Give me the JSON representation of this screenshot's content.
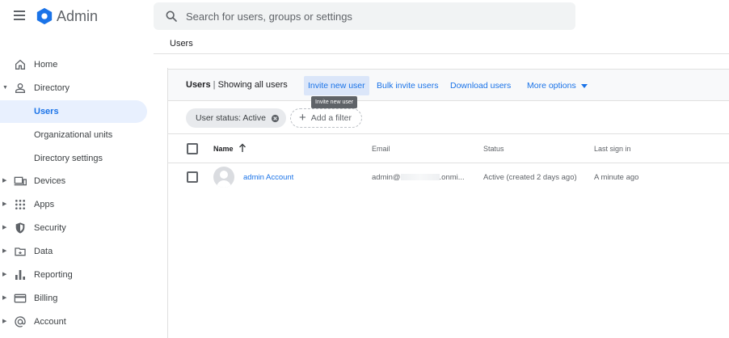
{
  "app": {
    "title": "Admin"
  },
  "search": {
    "placeholder": "Search for users, groups or settings"
  },
  "breadcrumb": "Users",
  "sidebar": {
    "items": [
      {
        "label": "Home",
        "icon": "home-icon"
      },
      {
        "label": "Directory",
        "icon": "person-icon",
        "expanded": true
      },
      {
        "label": "Users",
        "active": true
      },
      {
        "label": "Organizational units"
      },
      {
        "label": "Directory settings"
      },
      {
        "label": "Devices",
        "icon": "devices-icon"
      },
      {
        "label": "Apps",
        "icon": "apps-grid-icon"
      },
      {
        "label": "Security",
        "icon": "shield-icon"
      },
      {
        "label": "Data",
        "icon": "data-icon"
      },
      {
        "label": "Reporting",
        "icon": "bar-chart-icon"
      },
      {
        "label": "Billing",
        "icon": "credit-card-icon"
      },
      {
        "label": "Account",
        "icon": "at-sign-icon"
      }
    ]
  },
  "toolbar": {
    "title": "Users",
    "separator": "|",
    "subtitle": "Showing all users",
    "invite": "Invite new user",
    "bulk_invite": "Bulk invite users",
    "download": "Download users",
    "more": "More options",
    "tooltip": "Invite new user"
  },
  "filters": {
    "chip": "User status: Active",
    "add": "Add a filter"
  },
  "table": {
    "columns": {
      "name": "Name",
      "email": "Email",
      "status": "Status",
      "last_sign_in": "Last sign in"
    },
    "rows": [
      {
        "name": "admin Account",
        "email_prefix": "admin@",
        "email_suffix": ".onmi...",
        "status": "Active (created 2 days ago)",
        "last_sign_in": "A minute ago"
      }
    ]
  },
  "colors": {
    "accent": "#1a73e8",
    "active_bg": "#e8f0fe",
    "tooltip_bg": "#5f6368"
  }
}
